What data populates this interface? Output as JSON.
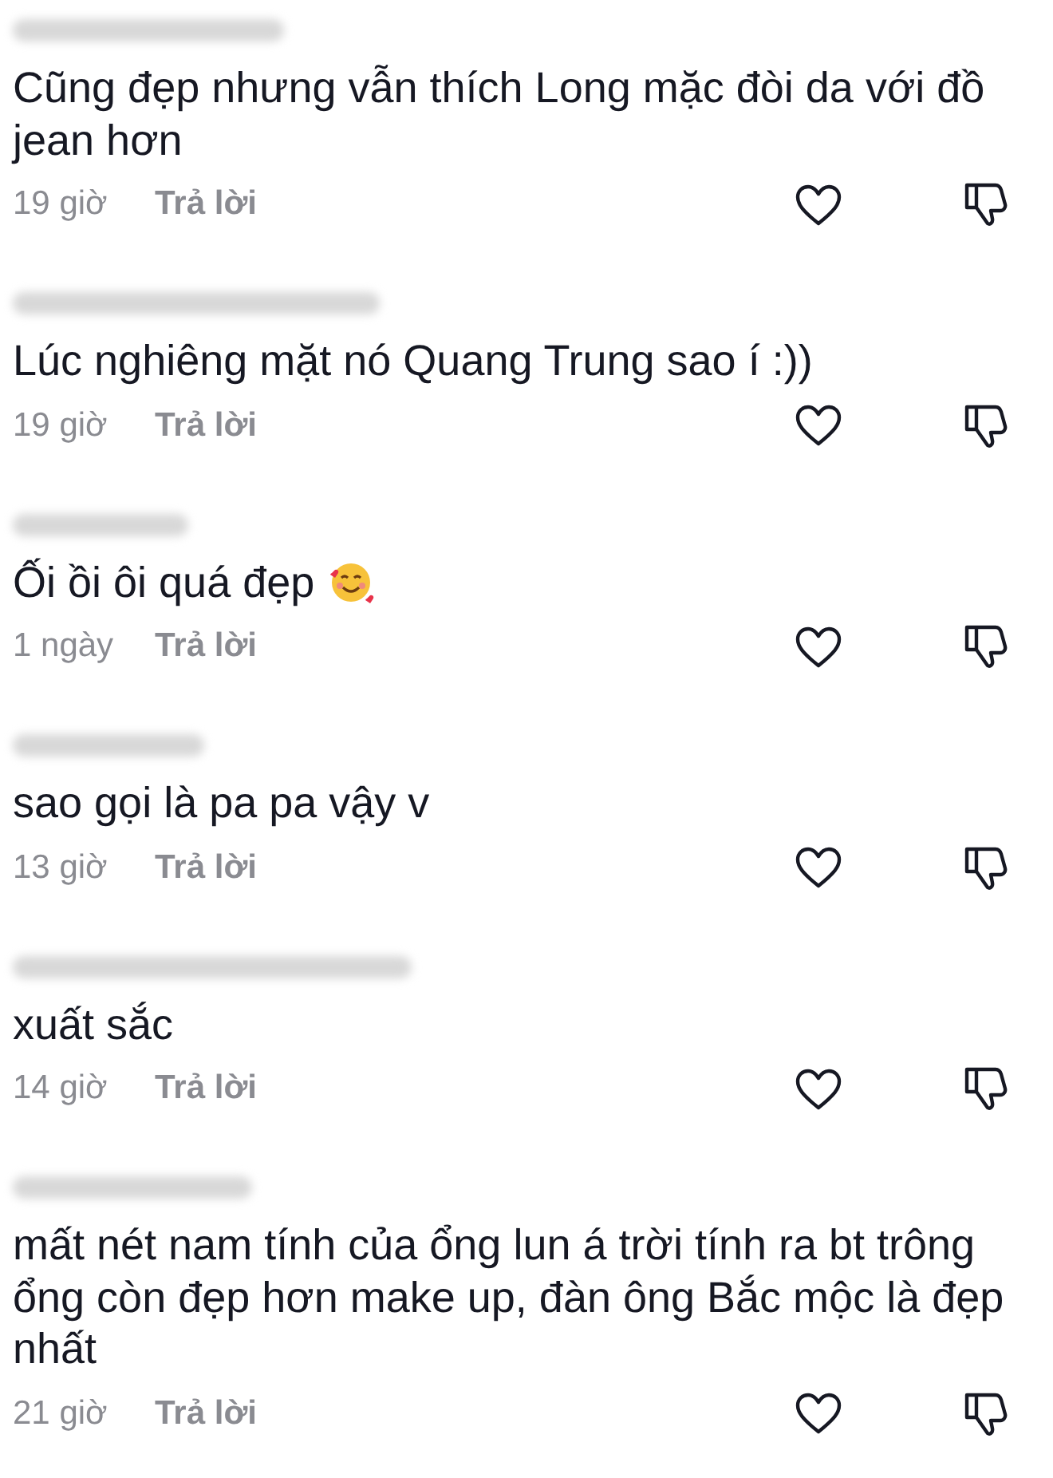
{
  "comments": [
    {
      "text": "Cũng đẹp nhưng vẫn thích Long mặc đòi da với đồ jean hơn",
      "has_emoji": false,
      "time": "19 giờ",
      "reply_label": "Trả lời"
    },
    {
      "text": "Lúc nghiêng mặt nó Quang Trung sao í :))",
      "has_emoji": false,
      "time": "19 giờ",
      "reply_label": "Trả lời"
    },
    {
      "text": "Ối ồi ôi quá đẹp",
      "has_emoji": true,
      "time": "1 ngày",
      "reply_label": "Trả lời"
    },
    {
      "text": "sao gọi là pa pa vậy v",
      "has_emoji": false,
      "time": "13 giờ",
      "reply_label": "Trả lời"
    },
    {
      "text": "xuất sắc",
      "has_emoji": false,
      "time": "14 giờ",
      "reply_label": "Trả lời"
    },
    {
      "text": "mất nét nam tính của ổng lun á trời tính ra bt trông ổng còn đẹp hơn make up, đàn ông Bắc mộc là đẹp nhất",
      "has_emoji": false,
      "time": "21 giờ",
      "reply_label": "Trả lời"
    }
  ]
}
